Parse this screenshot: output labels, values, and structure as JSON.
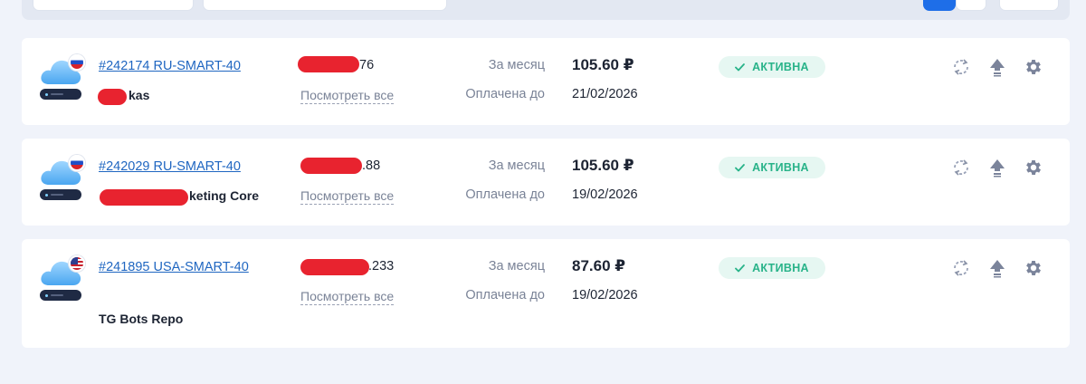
{
  "cards": [
    {
      "id_label": "#242174 RU-SMART-40",
      "name_visible": "kas",
      "ip_visible": "76",
      "view_all": "Посмотреть все",
      "month_label": "За месяц",
      "price": "105.60 ₽",
      "paid_label": "Оплачена до",
      "paid_date": "21/02/2026",
      "status": "АКТИВНА"
    },
    {
      "id_label": "#242029 RU-SMART-40",
      "name_visible": "keting Core",
      "ip_visible": ".88",
      "view_all": "Посмотреть все",
      "month_label": "За месяц",
      "price": "105.60 ₽",
      "paid_label": "Оплачена до",
      "paid_date": "19/02/2026",
      "status": "АКТИВНА"
    },
    {
      "id_label": "#241895 USA-SMART-40",
      "name_visible": "TG Bots Repo",
      "ip_visible": ".233",
      "view_all": "Посмотреть все",
      "month_label": "За месяц",
      "price": "87.60 ₽",
      "paid_label": "Оплачена до",
      "paid_date": "19/02/2026",
      "status": "АКТИВНА"
    }
  ]
}
